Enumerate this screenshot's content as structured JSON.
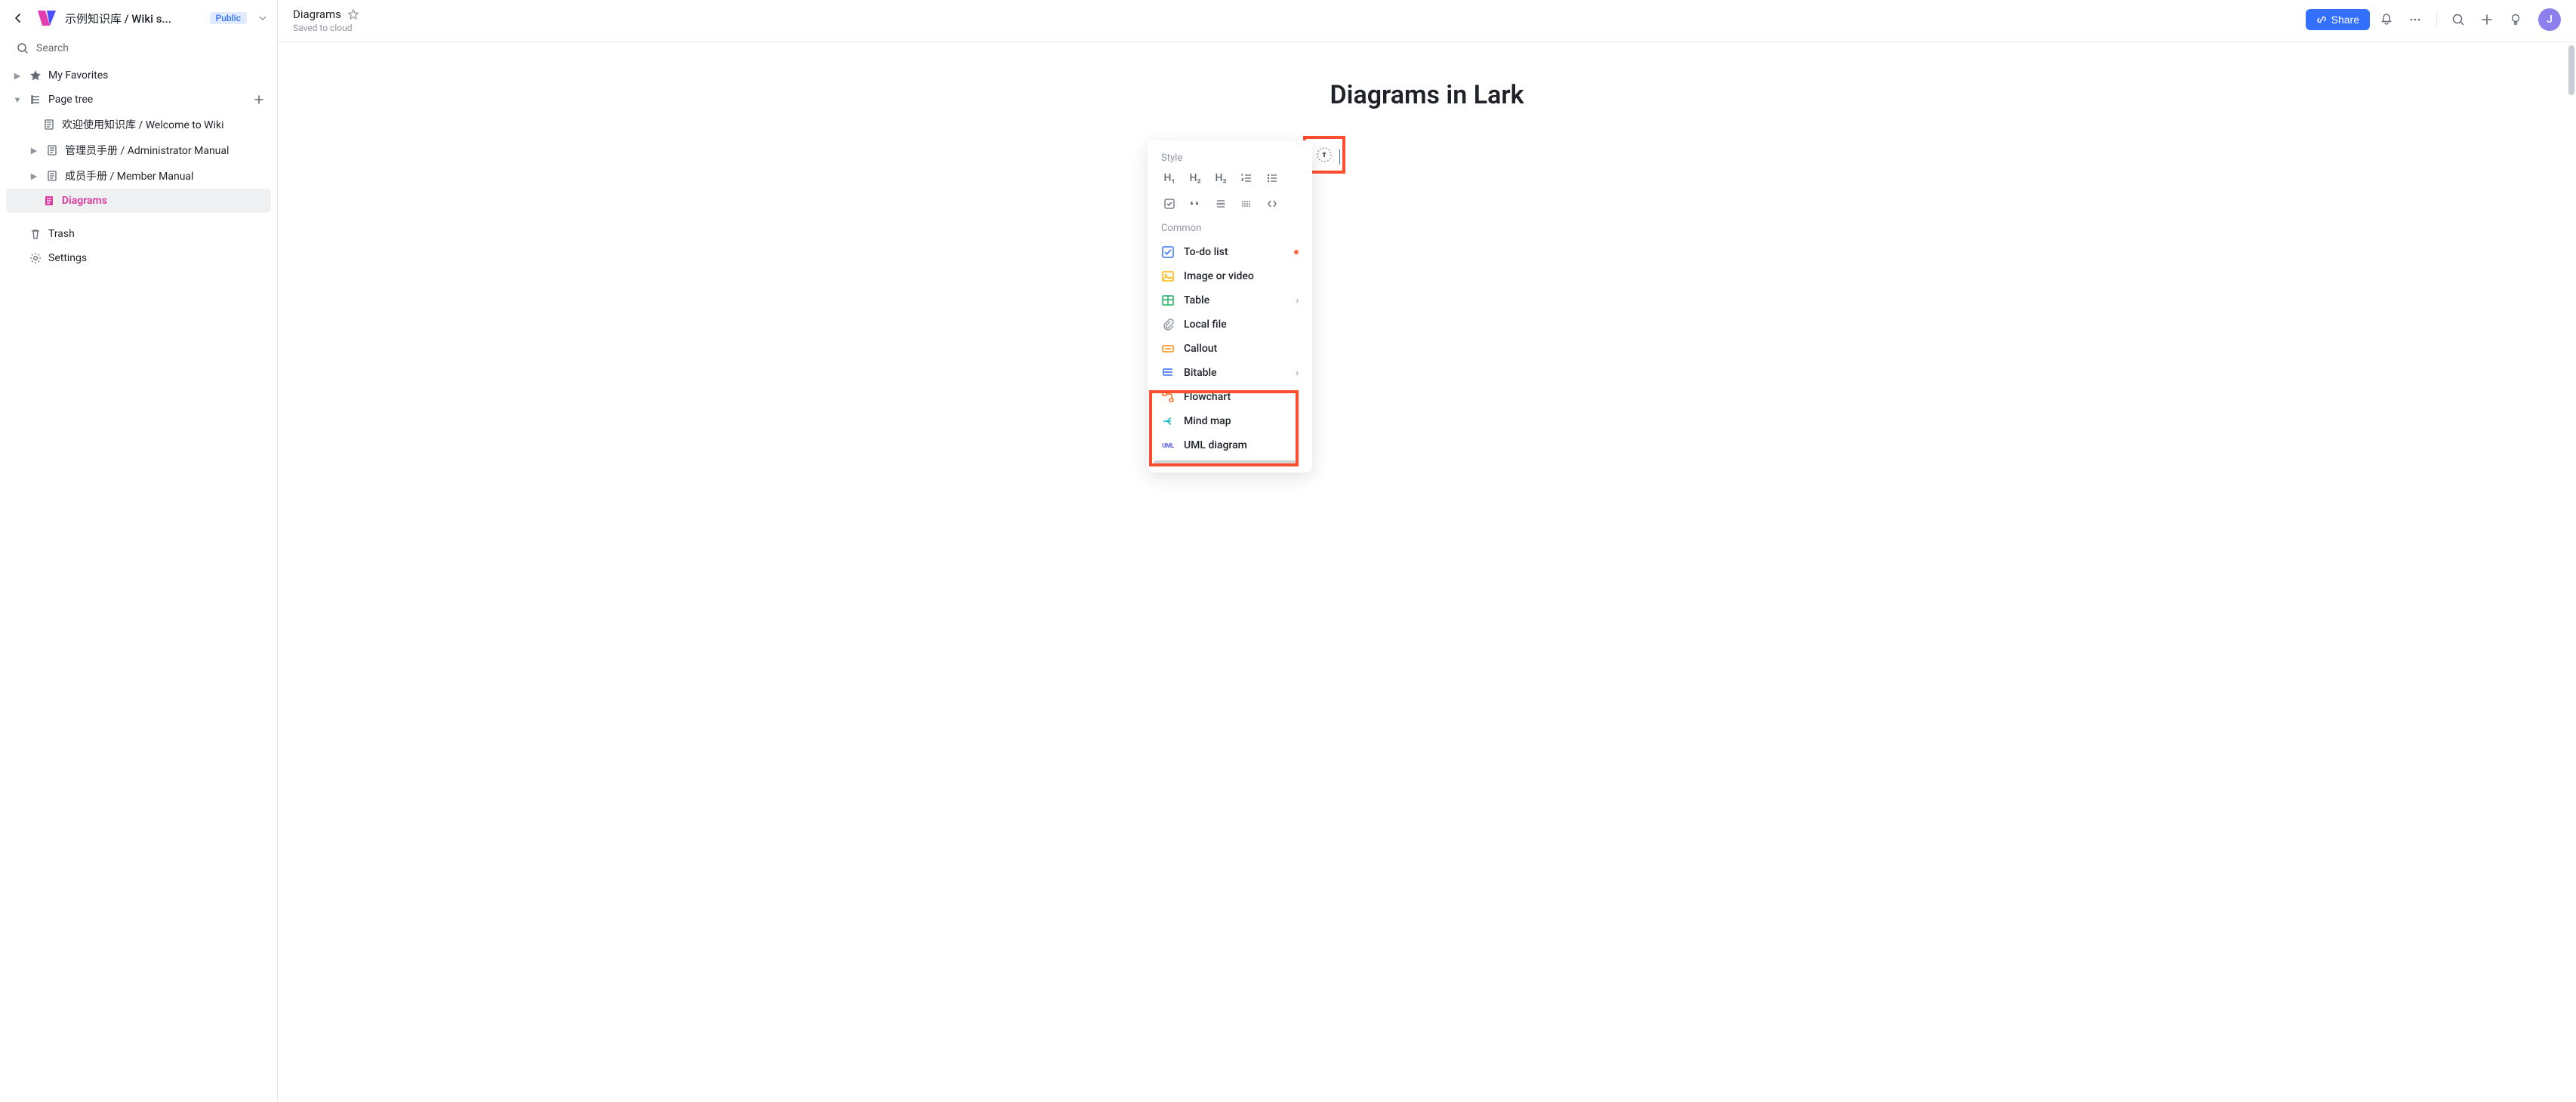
{
  "sidebar": {
    "breadcrumb": "示例知识库 / Wiki s...",
    "badge": "Public",
    "search": "Search",
    "favorites": "My Favorites",
    "page_tree": "Page tree",
    "items": [
      {
        "label": "欢迎使用知识库 / Welcome to Wiki",
        "expandable": false
      },
      {
        "label": "管理员手册 / Administrator Manual",
        "expandable": true
      },
      {
        "label": "成员手册 / Member Manual",
        "expandable": true
      },
      {
        "label": "Diagrams",
        "current": true
      }
    ],
    "trash": "Trash",
    "settings": "Settings"
  },
  "topbar": {
    "title": "Diagrams",
    "status": "Saved to cloud",
    "share": "Share",
    "avatar": "J"
  },
  "document": {
    "title": "Diagrams in Lark"
  },
  "insert_menu": {
    "style_header": "Style",
    "style_items": [
      "H₁",
      "H₂",
      "H₃"
    ],
    "common_header": "Common",
    "items": [
      {
        "label": "To-do list",
        "icon": "todo",
        "color": "#3370ff",
        "dot": true
      },
      {
        "label": "Image or video",
        "icon": "image",
        "color": "#ffb300"
      },
      {
        "label": "Table",
        "icon": "table",
        "color": "#25b160",
        "submenu": true
      },
      {
        "label": "Local file",
        "icon": "attach",
        "color": "#8f959e"
      },
      {
        "label": "Callout",
        "icon": "callout",
        "color": "#ff8800"
      },
      {
        "label": "Bitable",
        "icon": "bitable",
        "color": "#3370ff",
        "submenu": true
      },
      {
        "label": "Flowchart",
        "icon": "flowchart",
        "color": "#ff6b1a"
      },
      {
        "label": "Mind map",
        "icon": "mindmap",
        "color": "#13b9c9"
      },
      {
        "label": "UML diagram",
        "icon": "uml",
        "color": "#5b5be6"
      }
    ]
  }
}
